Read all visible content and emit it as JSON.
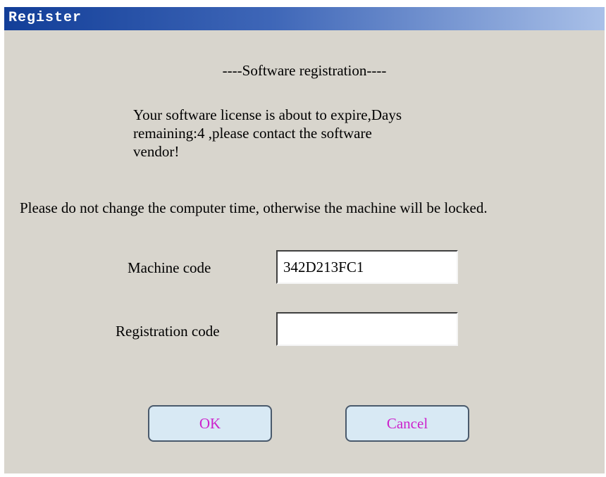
{
  "window": {
    "title": "Register"
  },
  "heading": "----Software registration----",
  "message_lines": [
    "Your software license is about to expire,Days",
    "remaining:4 ,please contact the software",
    "vendor!"
  ],
  "warning": "Please do not change the computer time, otherwise the machine will be locked.",
  "form": {
    "machine_code_label": "Machine code",
    "machine_code_value": "342D213FC1",
    "registration_code_label": "Registration code",
    "registration_code_value": ""
  },
  "buttons": {
    "ok": "OK",
    "cancel": "Cancel"
  },
  "colors": {
    "window_bg": "#d8d5cd",
    "titlebar_start": "#123e98",
    "titlebar_end": "#a9c0e8",
    "button_bg": "#d8e9f4",
    "button_text": "#cc22cc"
  }
}
